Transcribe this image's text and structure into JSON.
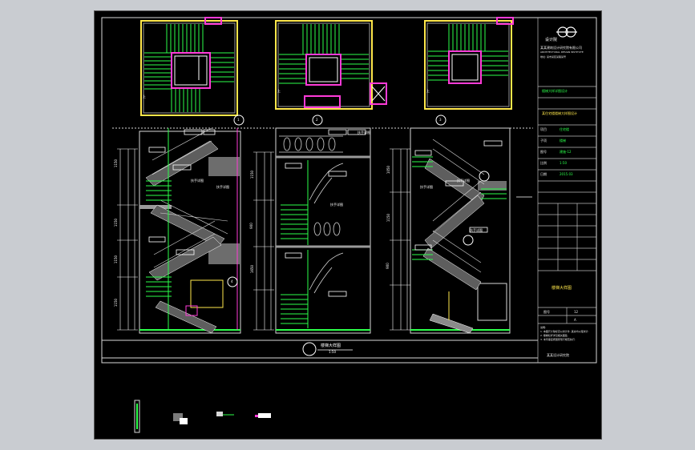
{
  "app": {
    "name": "AutoCAD-style drawing viewer"
  },
  "drawing": {
    "section_title": "楼梯大样图",
    "section_scale": "1:50",
    "colors": {
      "background": "#000000",
      "green": "#2bff4a",
      "yellow": "#ffe74b",
      "magenta": "#ff3bd8",
      "white": "#ffffff",
      "grey_hatch": "#9a9a9a",
      "cyan": "#33d6ff",
      "red": "#ff2d2d"
    },
    "plan_labels": [
      "上",
      "上",
      "上"
    ],
    "callouts": [
      "扶手详图",
      "扶手详图",
      "扶手详图",
      "扶手详图",
      "扶手详图",
      "扶手详图",
      "扶手详图"
    ],
    "callout_bubbles": [
      "1",
      "2",
      "3",
      "4"
    ],
    "dimension_labels_left": [
      "1150",
      "150",
      "1150",
      "150",
      "1150",
      "150",
      "1150",
      "150",
      "1150"
    ],
    "dimension_labels_right": [
      "900",
      "1650",
      "1050",
      "1150",
      "900"
    ]
  },
  "title_block": {
    "logo_text": "设计院",
    "company_line_1": "某某建筑设计研究院有限公司",
    "company_line_2": "ARCHITECTURAL DESIGN INSTITUTE",
    "company_line_3": "地址: 某市某区某路某号",
    "project_label": "楼梯大样详图设计",
    "project_name": "某住宅楼楼梯大样图设计",
    "fields": [
      {
        "label": "项目",
        "value": "住宅楼"
      },
      {
        "label": "子项",
        "value": "楼梯"
      },
      {
        "label": "图号",
        "value": "建施-12"
      },
      {
        "label": "比例",
        "value": "1:50"
      },
      {
        "label": "日期",
        "value": "2015.03"
      }
    ],
    "drawing_title": "楼梯大样图",
    "sheet_no_label": "图号",
    "sheet_no": "12",
    "revision": "A",
    "notes": [
      "说明:",
      "1. 本图尺寸除标高以米计外, 其余均以毫米计.",
      "2. 楼梯栏杆详见相关图集.",
      "3. 未尽事宜按国家现行规范执行."
    ],
    "footer_text": "某某设计研究院"
  }
}
